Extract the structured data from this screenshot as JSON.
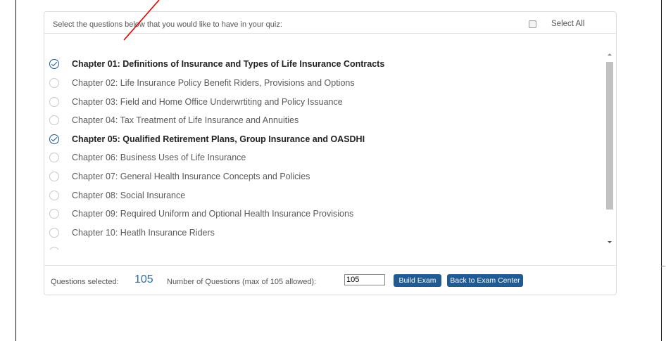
{
  "header": {
    "instruction": "Select the questions below that you would like to have in your quiz:",
    "select_all_label": "Select All"
  },
  "chapters": [
    {
      "label": "Chapter 01: Definitions of Insurance and Types of Life Insurance Contracts",
      "checked": true
    },
    {
      "label": "Chapter 02: Life Insurance Policy Benefit Riders, Provisions and Options",
      "checked": false
    },
    {
      "label": "Chapter 03: Field and Home Office Underwrtiting and Policy Issuance",
      "checked": false
    },
    {
      "label": "Chapter 04: Tax Treatment of Life Insurance and Annuities",
      "checked": false
    },
    {
      "label": "Chapter 05: Qualified Retirement Plans, Group Insurance and OASDHI",
      "checked": true
    },
    {
      "label": "Chapter 06: Business Uses of Life Insurance",
      "checked": false
    },
    {
      "label": "Chapter 07: General Health Insurance Concepts and Policies",
      "checked": false
    },
    {
      "label": "Chapter 08: Social Insurance",
      "checked": false
    },
    {
      "label": "Chapter 09: Required Uniform and Optional Health Insurance Provisions",
      "checked": false
    },
    {
      "label": "Chapter 10: Heatlh Insurance Riders",
      "checked": false
    }
  ],
  "footer": {
    "questions_selected_label": "Questions selected:",
    "questions_selected_value": "105",
    "num_questions_label": "Number of Questions (max of 105 allowed):",
    "num_questions_value": "105",
    "build_exam_label": "Build Exam",
    "back_label": "Back to Exam Center"
  },
  "colors": {
    "accent": "#1f5a93",
    "count_blue": "#2e6da4",
    "annotation_arrow": "#e00000"
  }
}
